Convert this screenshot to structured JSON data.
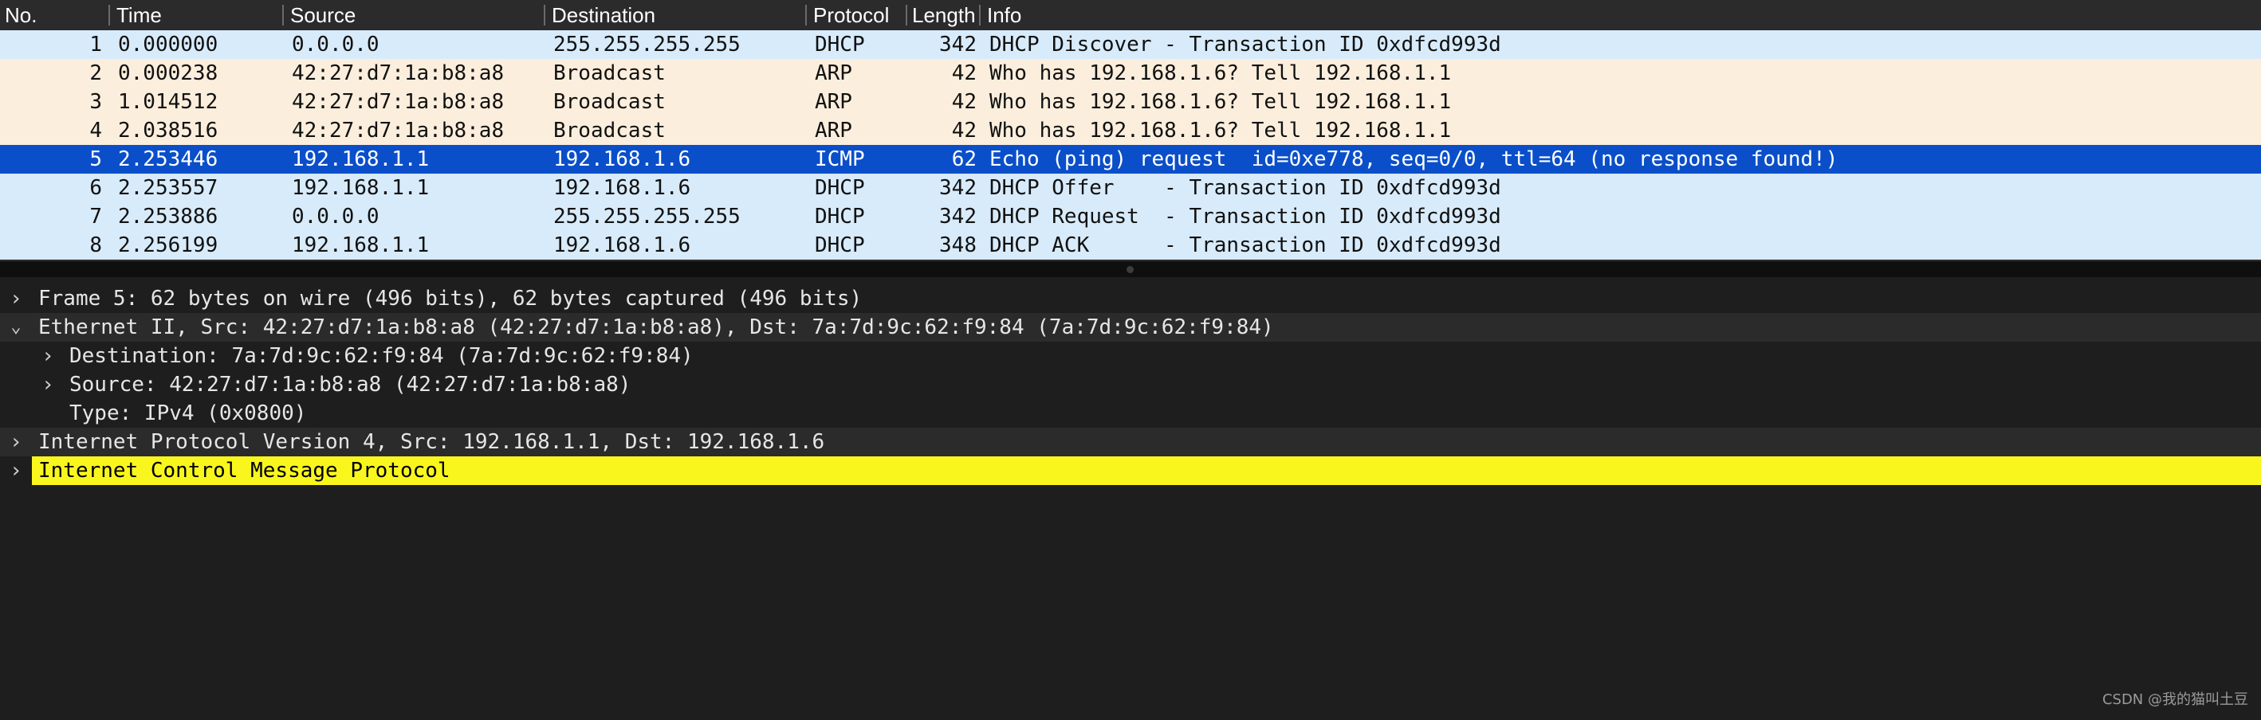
{
  "packet_list": {
    "columns": [
      "No.",
      "Time",
      "Source",
      "Destination",
      "Protocol",
      "Length",
      "Info"
    ],
    "rows": [
      {
        "no": "1",
        "time": "0.000000",
        "source": "0.0.0.0",
        "destination": "255.255.255.255",
        "protocol": "DHCP",
        "length": "342",
        "info": "DHCP Discover - Transaction ID 0xdfcd993d",
        "style": "dhcp"
      },
      {
        "no": "2",
        "time": "0.000238",
        "source": "42:27:d7:1a:b8:a8",
        "destination": "Broadcast",
        "protocol": "ARP",
        "length": "42",
        "info": "Who has 192.168.1.6? Tell 192.168.1.1",
        "style": "arp"
      },
      {
        "no": "3",
        "time": "1.014512",
        "source": "42:27:d7:1a:b8:a8",
        "destination": "Broadcast",
        "protocol": "ARP",
        "length": "42",
        "info": "Who has 192.168.1.6? Tell 192.168.1.1",
        "style": "arp"
      },
      {
        "no": "4",
        "time": "2.038516",
        "source": "42:27:d7:1a:b8:a8",
        "destination": "Broadcast",
        "protocol": "ARP",
        "length": "42",
        "info": "Who has 192.168.1.6? Tell 192.168.1.1",
        "style": "arp"
      },
      {
        "no": "5",
        "time": "2.253446",
        "source": "192.168.1.1",
        "destination": "192.168.1.6",
        "protocol": "ICMP",
        "length": "62",
        "info": "Echo (ping) request  id=0xe778, seq=0/0, ttl=64 (no response found!)",
        "style": "sel"
      },
      {
        "no": "6",
        "time": "2.253557",
        "source": "192.168.1.1",
        "destination": "192.168.1.6",
        "protocol": "DHCP",
        "length": "342",
        "info": "DHCP Offer    - Transaction ID 0xdfcd993d",
        "style": "dhcp"
      },
      {
        "no": "7",
        "time": "2.253886",
        "source": "0.0.0.0",
        "destination": "255.255.255.255",
        "protocol": "DHCP",
        "length": "342",
        "info": "DHCP Request  - Transaction ID 0xdfcd993d",
        "style": "dhcp"
      },
      {
        "no": "8",
        "time": "2.256199",
        "source": "192.168.1.1",
        "destination": "192.168.1.6",
        "protocol": "DHCP",
        "length": "348",
        "info": "DHCP ACK      - Transaction ID 0xdfcd993d",
        "style": "dhcp"
      }
    ]
  },
  "details": {
    "frame": "Frame 5: 62 bytes on wire (496 bits), 62 bytes captured (496 bits)",
    "ethernet": "Ethernet II, Src: 42:27:d7:1a:b8:a8 (42:27:d7:1a:b8:a8), Dst: 7a:7d:9c:62:f9:84 (7a:7d:9c:62:f9:84)",
    "eth_destination": "Destination: 7a:7d:9c:62:f9:84 (7a:7d:9c:62:f9:84)",
    "eth_source": "Source: 42:27:d7:1a:b8:a8 (42:27:d7:1a:b8:a8)",
    "eth_type": "Type: IPv4 (0x0800)",
    "ipv4": "Internet Protocol Version 4, Src: 192.168.1.1, Dst: 192.168.1.6",
    "icmp": "Internet Control Message Protocol"
  },
  "icons": {
    "collapsed": "chevron-right-icon",
    "expanded": "chevron-down-icon",
    "collapsed_glyph": "›",
    "expanded_glyph": "⌄"
  },
  "colors": {
    "dhcp_row": "#d8ebfb",
    "arp_row": "#fbeedc",
    "selected_row": "#0a4fc9",
    "highlight": "#f9f61e",
    "panel_bg": "#1e1e1e"
  },
  "watermark": "CSDN @我的猫叫土豆"
}
